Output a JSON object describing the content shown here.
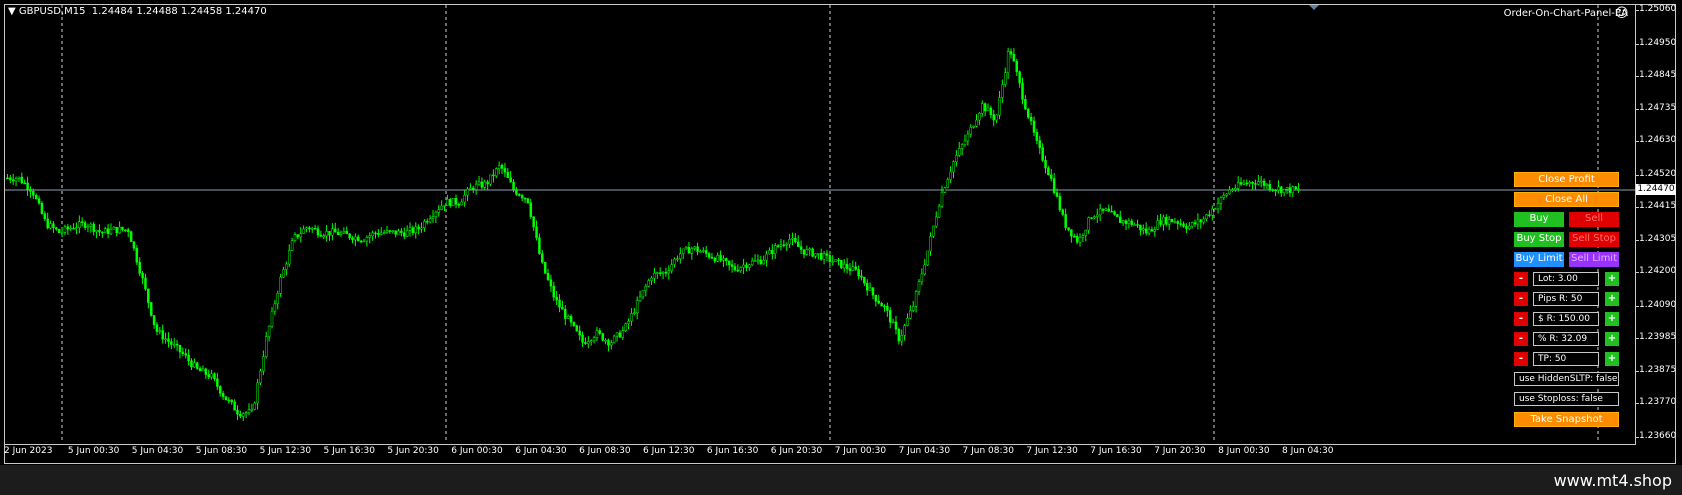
{
  "header": {
    "symbol": "GBPUSD,M15",
    "ohlc": "1.24484 1.24488 1.24458 1.24470",
    "ea_name": "Order-On-Chart-Panel-EA"
  },
  "current_price": "1.24470",
  "price_axis": [
    "1.25060",
    "1.24950",
    "1.24845",
    "1.24735",
    "1.24630",
    "1.24520",
    "1.24415",
    "1.24305",
    "1.24200",
    "1.24090",
    "1.23985",
    "1.23875",
    "1.23770",
    "1.23660"
  ],
  "time_axis": [
    "2 Jun 2023",
    "5 Jun 00:30",
    "5 Jun 04:30",
    "5 Jun 08:30",
    "5 Jun 12:30",
    "5 Jun 16:30",
    "5 Jun 20:30",
    "6 Jun 00:30",
    "6 Jun 04:30",
    "6 Jun 08:30",
    "6 Jun 12:30",
    "6 Jun 16:30",
    "6 Jun 20:30",
    "7 Jun 00:30",
    "7 Jun 04:30",
    "7 Jun 08:30",
    "7 Jun 12:30",
    "7 Jun 16:30",
    "7 Jun 20:30",
    "8 Jun 00:30",
    "8 Jun 04:30"
  ],
  "panel": {
    "close_profit": "Close Profit",
    "close_all": "Close All",
    "buy": "Buy",
    "sell": "Sell",
    "buy_stop": "Buy Stop",
    "sell_stop": "Sell Stop",
    "buy_limit": "Buy Limit",
    "sell_limit": "Sell Limit",
    "minus": "-",
    "plus": "+",
    "lot": "Lot: 3.00",
    "pips_r": "Pips R: 50",
    "usd_r": "$ R: 150.00",
    "pct_r": "% R: 32.09",
    "tp": "TP: 50",
    "hidden_sltp": "use HiddenSLTP: false",
    "use_stoploss": "use Stoploss: false",
    "take_snapshot": "Take Snapshot"
  },
  "watermark": "www.mt4.shop",
  "colors": {
    "candle": "#00ff00",
    "background": "#000000",
    "grid": "#c8c8c8",
    "close_btn": "#ff8c00"
  },
  "chart_data": {
    "type": "candlestick",
    "ylim": [
      1.2366,
      1.2506
    ],
    "price_line": 1.2447,
    "x": [
      "2 Jun 2023",
      "5 Jun 00:30",
      "5 Jun 04:30",
      "5 Jun 08:30",
      "5 Jun 12:30",
      "5 Jun 16:30",
      "5 Jun 20:30",
      "6 Jun 00:30",
      "6 Jun 04:30",
      "6 Jun 08:30",
      "6 Jun 12:30",
      "6 Jun 16:30",
      "6 Jun 20:30",
      "7 Jun 00:30",
      "7 Jun 04:30",
      "7 Jun 08:30",
      "7 Jun 12:30",
      "7 Jun 16:30",
      "7 Jun 20:30",
      "8 Jun 00:30",
      "8 Jun 04:30"
    ],
    "close_path": [
      1.2451,
      1.2451,
      1.2447,
      1.2436,
      1.2433,
      1.2435,
      1.2436,
      1.2433,
      1.2434,
      1.2434,
      1.2418,
      1.2401,
      1.2397,
      1.2393,
      1.2388,
      1.2386,
      1.2379,
      1.2374,
      1.2374,
      1.2398,
      1.2417,
      1.2431,
      1.2435,
      1.2433,
      1.2433,
      1.2432,
      1.2431,
      1.2433,
      1.2433,
      1.2433,
      1.2434,
      1.2439,
      1.2443,
      1.2443,
      1.2448,
      1.2449,
      1.2455,
      1.2447,
      1.2444,
      1.2423,
      1.2411,
      1.2404,
      1.2397,
      1.24,
      1.2397,
      1.2401,
      1.241,
      1.2419,
      1.242,
      1.2426,
      1.2428,
      1.2426,
      1.2424,
      1.2421,
      1.2423,
      1.2424,
      1.2428,
      1.2431,
      1.2427,
      1.2426,
      1.2424,
      1.2422,
      1.242,
      1.2413,
      1.2408,
      1.2398,
      1.2409,
      1.2426,
      1.2445,
      1.2457,
      1.2465,
      1.2475,
      1.247,
      1.2494,
      1.2477,
      1.2462,
      1.2451,
      1.2436,
      1.243,
      1.2439,
      1.244,
      1.2437,
      1.2436,
      1.2433,
      1.2437,
      1.2437,
      1.2435,
      1.2437,
      1.2442,
      1.2447,
      1.2449,
      1.245,
      1.2448,
      1.2447,
      1.2447
    ]
  }
}
